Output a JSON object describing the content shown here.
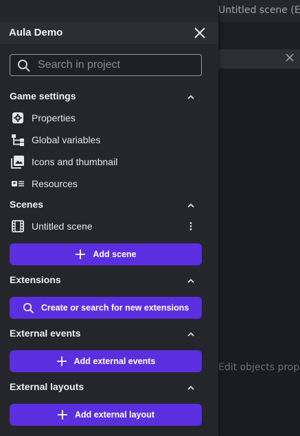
{
  "background": {
    "tab_title": "Untitled scene (Events)",
    "hint_text": "Edit objects properties"
  },
  "drawer": {
    "title": "Aula Demo",
    "search": {
      "placeholder": "Search in project",
      "value": ""
    },
    "game_settings": {
      "title": "Game settings",
      "items": [
        {
          "label": "Properties",
          "icon": "gear-icon"
        },
        {
          "label": "Global variables",
          "icon": "variables-tree-icon"
        },
        {
          "label": "Icons and thumbnail",
          "icon": "image-icon"
        },
        {
          "label": "Resources",
          "icon": "resources-icon"
        }
      ]
    },
    "scenes": {
      "title": "Scenes",
      "items": [
        {
          "label": "Untitled scene",
          "icon": "film-icon"
        }
      ],
      "add_button": "Add scene"
    },
    "extensions": {
      "title": "Extensions",
      "button": "Create or search for new extensions"
    },
    "external_events": {
      "title": "External events",
      "button": "Add external events"
    },
    "external_layouts": {
      "title": "External layouts",
      "button": "Add external layout"
    }
  },
  "colors": {
    "accent": "#5b2fe0",
    "drawer_bg": "#25252c",
    "header_bg": "#2d2d36"
  }
}
